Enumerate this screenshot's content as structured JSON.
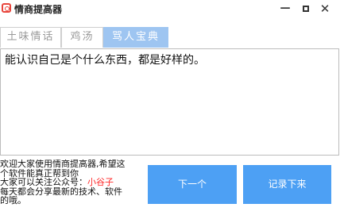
{
  "window": {
    "title": "情商提高器",
    "minimize_glyph": "—",
    "close_glyph": "✕"
  },
  "tabs": [
    {
      "label": "土味情话",
      "active": false
    },
    {
      "label": "鸡汤",
      "active": false
    },
    {
      "label": "骂人宝典",
      "active": true
    }
  ],
  "content": {
    "text": "能认识自己是个什么东西，都是好样的。"
  },
  "info": {
    "line1": "欢迎大家使用情商提高器,希望这",
    "line2": "个软件能真正帮到你",
    "line3_prefix": "大家可以关注公众号：",
    "wechat_name": "小谷子",
    "line4": "每天都会分享最新的技术、软件",
    "line5": "的哦。"
  },
  "buttons": {
    "next": "下一个",
    "record": "记录下来"
  },
  "colors": {
    "accent": "#4da0f4",
    "active_tab": "#9ec5f1",
    "highlight": "#ff2a2a",
    "icon": "#e8453c"
  },
  "icons": {
    "app": "app-logo-icon",
    "minimize": "minimize-icon",
    "maximize": "maximize-icon",
    "close": "close-icon"
  }
}
